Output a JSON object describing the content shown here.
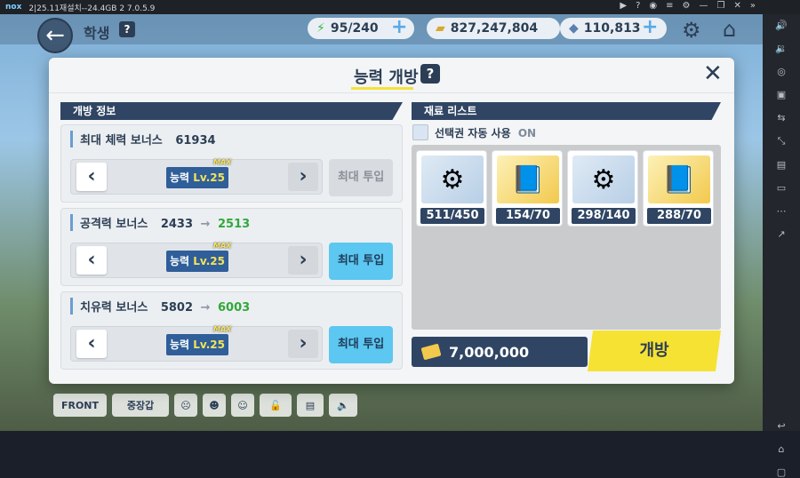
{
  "emulator": {
    "title": "2|25.11재설치--24.4GB 2  7.0.5.9",
    "logo": "nox"
  },
  "topbar": {
    "screen_title": "학생",
    "help": "?",
    "ap": "95/240",
    "credits": "827,247,804",
    "gems": "110,813"
  },
  "bottom_bar": {
    "front_label": "FRONT",
    "equip_label": "중장갑"
  },
  "modal": {
    "title": "능력 개방",
    "help": "?",
    "close": "✕",
    "left_section_title": "개방 정보",
    "right_section_title": "재료 리스트",
    "bonuses": [
      {
        "label": "최대 체력 보너스",
        "value": "61934",
        "next": "",
        "arrow": "",
        "level_prefix": "능력 ",
        "level": "Lv.25",
        "max_tag": "MAX",
        "max_button": "최대 투입",
        "max_enabled": false
      },
      {
        "label": "공격력 보너스",
        "value": "2433",
        "next": "2513",
        "arrow": "→",
        "level_prefix": "능력 ",
        "level": "Lv.25",
        "max_tag": "MAX",
        "max_button": "최대 투입",
        "max_enabled": true
      },
      {
        "label": "치유력 보너스",
        "value": "5802",
        "next": "6003",
        "arrow": "→",
        "level_prefix": "능력 ",
        "level": "Lv.25",
        "max_tag": "MAX",
        "max_button": "최대 투입",
        "max_enabled": true
      }
    ],
    "auto_select_label": "선택권 자동 사용",
    "auto_select_state": "ON",
    "materials": [
      {
        "count": "511/450",
        "icon": "gear-disc-icon"
      },
      {
        "count": "154/70",
        "icon": "report-book-icon"
      },
      {
        "count": "298/140",
        "icon": "gear-disc-icon"
      },
      {
        "count": "288/70",
        "icon": "report-book-icon"
      }
    ],
    "cost": "7,000,000",
    "open_button": "개방"
  },
  "colors": {
    "navy": "#2f4563",
    "accent_yellow": "#f6e233",
    "accent_cyan": "#5cc7f0",
    "increase_green": "#31a83a"
  }
}
